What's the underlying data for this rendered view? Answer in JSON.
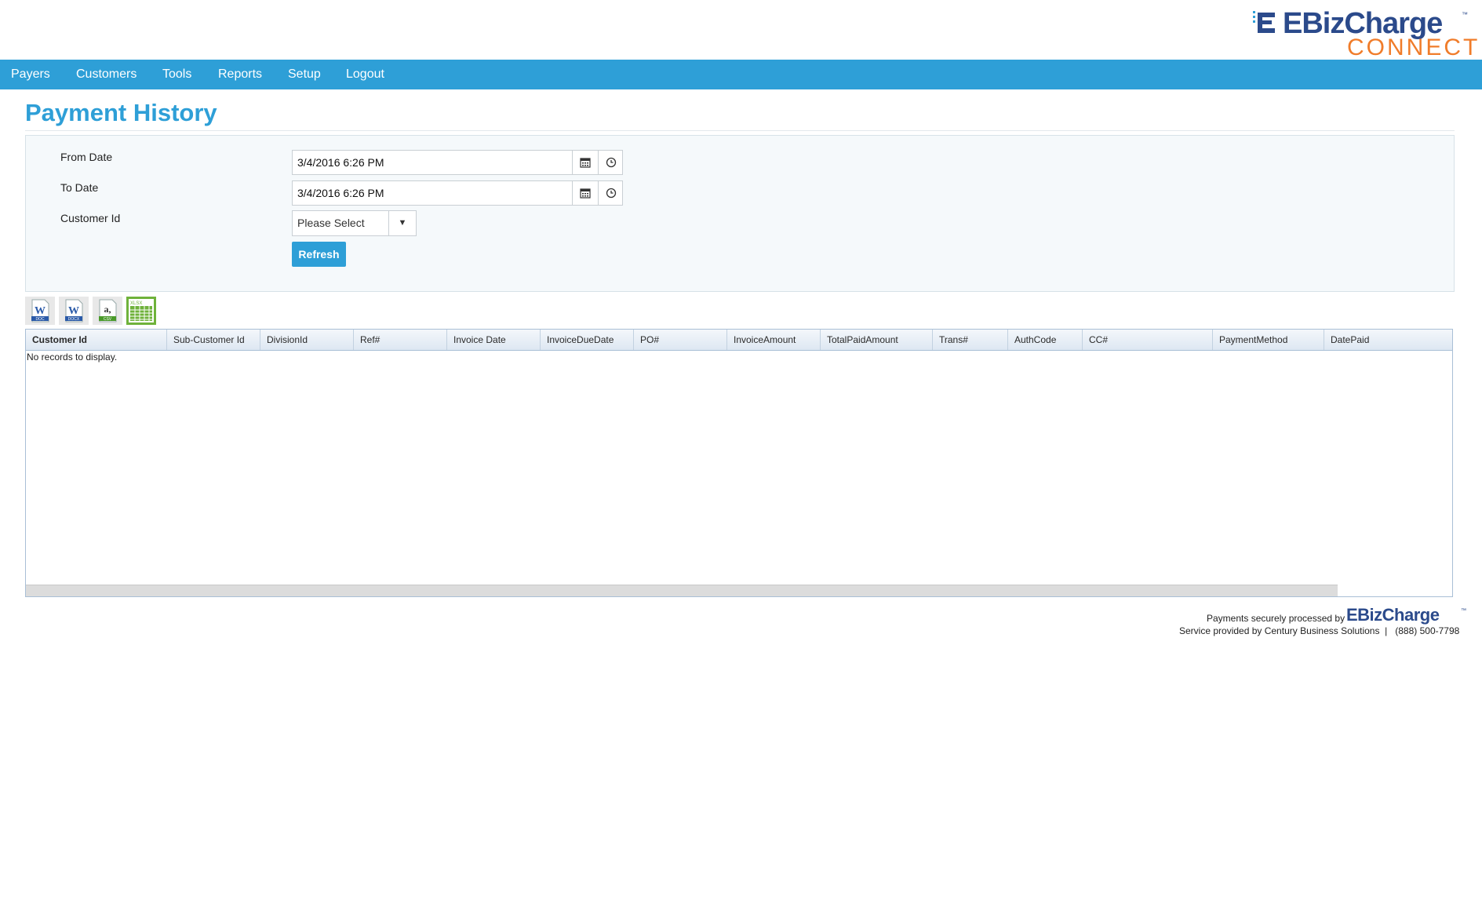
{
  "brand": {
    "logo_main": "EBizCharge",
    "logo_sub": "CONNECT",
    "trademark": "™",
    "primary_color": "#2e9fd7",
    "logo_blue": "#2b4a8b",
    "logo_orange": "#f07c2a"
  },
  "nav": {
    "items": [
      {
        "label": "Payers"
      },
      {
        "label": "Customers"
      },
      {
        "label": "Tools"
      },
      {
        "label": "Reports"
      },
      {
        "label": "Setup"
      },
      {
        "label": "Logout"
      }
    ]
  },
  "page": {
    "title": "Payment History"
  },
  "filters": {
    "from_date_label": "From Date",
    "from_date_value": "3/4/2016 6:26 PM",
    "to_date_label": "To Date",
    "to_date_value": "3/4/2016 6:26 PM",
    "customer_id_label": "Customer Id",
    "customer_id_selected": "Please Select",
    "refresh_label": "Refresh"
  },
  "exports": {
    "items": [
      {
        "name": "doc-export-icon",
        "letter": "W",
        "tag": "DOC"
      },
      {
        "name": "docx-export-icon",
        "letter": "W",
        "tag": "DOCX"
      },
      {
        "name": "csv-export-icon",
        "letter": "a,",
        "tag": "CSV"
      },
      {
        "name": "xlsx-export-icon",
        "letter": "",
        "tag": "XLSX"
      }
    ]
  },
  "grid": {
    "columns": [
      "Customer Id",
      "Sub-Customer Id",
      "DivisionId",
      "Ref#",
      "Invoice Date",
      "InvoiceDueDate",
      "PO#",
      "InvoiceAmount",
      "TotalPaidAmount",
      "Trans#",
      "AuthCode",
      "CC#",
      "PaymentMethod",
      "DatePaid"
    ],
    "empty_message": "No records to display."
  },
  "footer": {
    "processed_by": "Payments securely processed by",
    "processor_logo": "EBizCharge",
    "service_line": "Service provided by Century Business Solutions  |   (888) 500-7798"
  }
}
